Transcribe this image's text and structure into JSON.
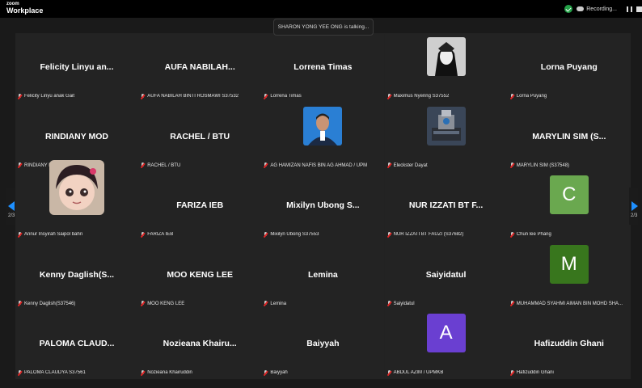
{
  "app": {
    "logo_line1": "zoom",
    "logo_line2": "Workplace"
  },
  "status": {
    "recording_label": "Recording..."
  },
  "talking_banner": "SHARON YONG YEE ONG is talking...",
  "pagination": {
    "left": "2/3",
    "right": "2/3"
  },
  "colors": {
    "accent": "#1e90ff",
    "recording": "#24a148",
    "muted_mic": "#e02424"
  },
  "participants": [
    {
      "display": "Felicity  Linyu  an...",
      "label": "Felicity Linyu anak Gait",
      "avatar": "none"
    },
    {
      "display": "AUFA  NABILAH...",
      "label": "AUFA NABILAH BINTI ROSMAWI S37532",
      "avatar": "none"
    },
    {
      "display": "Lorrena Timas",
      "label": "Lorrena Timas",
      "avatar": "none"
    },
    {
      "display": "",
      "label": "Maximus Nyering S37552",
      "avatar": "photo-anime-dark"
    },
    {
      "display": "Lorna Puyang",
      "label": "Lorna Puyang",
      "avatar": "none"
    },
    {
      "display": "RINDIANY MOD",
      "label": "RINDIANY MOD",
      "avatar": "none"
    },
    {
      "display": "RACHEL / BTU",
      "label": "RACHEL / BTU",
      "avatar": "none"
    },
    {
      "display": "",
      "label": "AG HAMIZAN NAFIS BIN AG AHMAD / UPM",
      "avatar": "photo-portrait-blue"
    },
    {
      "display": "",
      "label": "Eleckster Dayat",
      "avatar": "photo-robot"
    },
    {
      "display": "MARYLIN  SIM  (S...",
      "label": "MARYLIN SIM (S37548)",
      "avatar": "none"
    },
    {
      "display": "",
      "label": "Annur Insyirah Saipol bahri",
      "avatar": "photo-cartoon-girl"
    },
    {
      "display": "FARIZA IEB",
      "label": "FARIZA IEB",
      "avatar": "none"
    },
    {
      "display": "Mixilyn  Ubong  S...",
      "label": "Mixilyn Ubong S37553",
      "avatar": "none"
    },
    {
      "display": "NUR  IZZATI  BT  F...",
      "label": "NUR IZZATI BT FAUZI (S37682)",
      "avatar": "none"
    },
    {
      "display": "",
      "label": "Chun lee Phang",
      "avatar": "letter",
      "letter": "C",
      "color": "#6aa84f"
    },
    {
      "display": "Kenny  Daglish(S...",
      "label": "Kenny Daglish(S37546)",
      "avatar": "none"
    },
    {
      "display": "MOO KENG LEE",
      "label": "MOO KENG LEE",
      "avatar": "none"
    },
    {
      "display": "Lemina",
      "label": "Lemina",
      "avatar": "none"
    },
    {
      "display": "Saiyidatul",
      "label": "Saiyidatul",
      "avatar": "none"
    },
    {
      "display": "",
      "label": "MUHAMMAD SYAHMI AIMAN BIN MOHD SHA...",
      "avatar": "letter",
      "letter": "M",
      "color": "#38761d"
    },
    {
      "display": "PALOMA  CLAUD...",
      "label": "PALOMA CLAUDYA S37561",
      "avatar": "none"
    },
    {
      "display": "Nozieana  Khairu...",
      "label": "Nozieana Khairuddin",
      "avatar": "none"
    },
    {
      "display": "Baiyyah",
      "label": "Baiyyah",
      "avatar": "none"
    },
    {
      "display": "",
      "label": "ABDUL AZIM / UPMKB",
      "avatar": "letter",
      "letter": "A",
      "color": "#6a3fd1"
    },
    {
      "display": "Hafizuddin Ghani",
      "label": "Hafizuddin Ghani",
      "avatar": "none"
    }
  ]
}
